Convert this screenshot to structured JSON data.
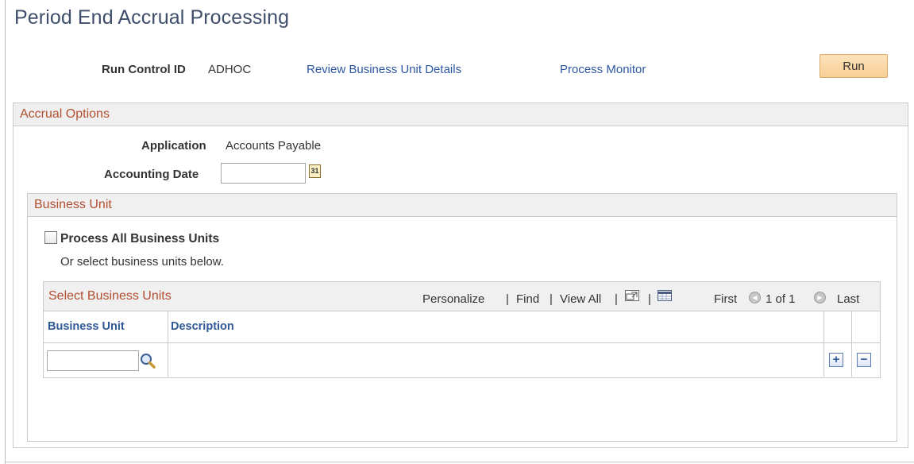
{
  "page": {
    "title": "Period End Accrual Processing"
  },
  "run_control": {
    "label": "Run Control ID",
    "value": "ADHOC"
  },
  "links": {
    "review": "Review Business Unit Details",
    "monitor": "Process Monitor"
  },
  "run_button": "Run",
  "accrual_options": {
    "header": "Accrual Options",
    "application_label": "Application",
    "application_value": "Accounts Payable",
    "accounting_date_label": "Accounting Date",
    "accounting_date_value": "",
    "calendar_glyph": "31"
  },
  "business_unit": {
    "header": "Business Unit",
    "process_all_label": "Process All Business Units",
    "process_all_checked": false,
    "hint": "Or select business units below."
  },
  "grid": {
    "title": "Select Business Units",
    "personalize": "Personalize",
    "find": "Find",
    "view_all": "View All",
    "separator": "|",
    "first": "First",
    "range": "1 of 1",
    "last": "Last",
    "columns": [
      "Business Unit",
      "Description"
    ],
    "rows": [
      {
        "business_unit": "",
        "description": ""
      }
    ],
    "add_glyph": "+",
    "delete_glyph": "−",
    "prev_glyph": "◀",
    "next_glyph": "▶"
  },
  "colors": {
    "title": "#3f4e6a",
    "link": "#2e57a3",
    "section_header_text": "#b24f30",
    "section_header_bg": "#f0f0f0",
    "column_header_text": "#2f5896",
    "run_button": "#f8cf95"
  },
  "icons": [
    "calendar-icon",
    "lookup-icon",
    "new-window-icon",
    "download-icon",
    "prev-arrow-icon",
    "next-arrow-icon",
    "add-row-icon",
    "delete-row-icon"
  ]
}
